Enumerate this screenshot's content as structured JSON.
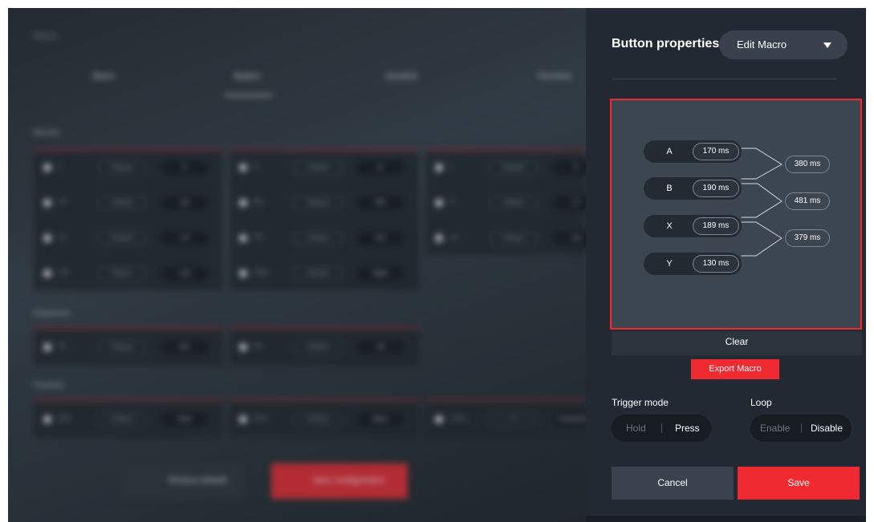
{
  "background": {
    "return_label": "Return",
    "tabs": [
      "Basic",
      "Button",
      "Joystick",
      "Function"
    ],
    "sections": [
      "Normal",
      "Expansion",
      "Function"
    ],
    "normal_rows": [
      [
        {
          "name": "A",
          "mapping": "Default",
          "value": "A"
        },
        {
          "name": "B",
          "mapping": "Default",
          "value": "B"
        },
        {
          "name": "Y",
          "mapping": "Default",
          "value": "X"
        }
      ],
      [
        {
          "name": "LB",
          "mapping": "Default",
          "value": "LB"
        },
        {
          "name": "RB",
          "mapping": "Default",
          "value": "RB"
        },
        {
          "name": "LT",
          "mapping": "Default",
          "value": "LT"
        }
      ],
      [
        {
          "name": "LS",
          "mapping": "Default",
          "value": "LS"
        },
        {
          "name": "RS",
          "mapping": "Default",
          "value": "RS"
        },
        {
          "name": "Up",
          "mapping": "Default",
          "value": "Up"
        }
      ],
      [
        {
          "name": "Left",
          "mapping": "Return",
          "value": "Left"
        },
        {
          "name": "Right",
          "mapping": "Default",
          "value": "Right"
        }
      ]
    ],
    "expansion_rows": [
      {
        "name": "M1",
        "mapping": "Default",
        "value": "M1"
      },
      {
        "name": "M2",
        "mapping": "Default",
        "value": "LB"
      }
    ],
    "function_rows": [
      {
        "name": "Start",
        "mapping": "Default",
        "value": "Start"
      },
      {
        "name": "Back",
        "mapping": "Default",
        "value": "Back"
      },
      {
        "name": "Turbo",
        "mapping": "0",
        "value": "Time/second"
      }
    ],
    "restore_label": "Restore default",
    "save_config_label": "Save configuration"
  },
  "panel": {
    "title": "Button properties",
    "mode_select": "Edit Macro",
    "macro": {
      "keys": [
        {
          "key": "A",
          "duration": "170 ms"
        },
        {
          "key": "B",
          "duration": "190 ms"
        },
        {
          "key": "X",
          "duration": "189 ms"
        },
        {
          "key": "Y",
          "duration": "130 ms"
        }
      ],
      "gaps": [
        "380 ms",
        "481 ms",
        "379 ms"
      ]
    },
    "clear_label": "Clear",
    "export_label": "Export Macro",
    "trigger_mode": {
      "label": "Trigger mode",
      "options": [
        "Hold",
        "Press"
      ],
      "selected": "Press"
    },
    "loop": {
      "label": "Loop",
      "options": [
        "Enable",
        "Disable"
      ],
      "selected": "Disable"
    },
    "cancel_label": "Cancel",
    "save_label": "Save"
  },
  "colors": {
    "accent": "#ef2b31",
    "panel_bg": "#222932",
    "macro_bg": "#3c4651"
  }
}
